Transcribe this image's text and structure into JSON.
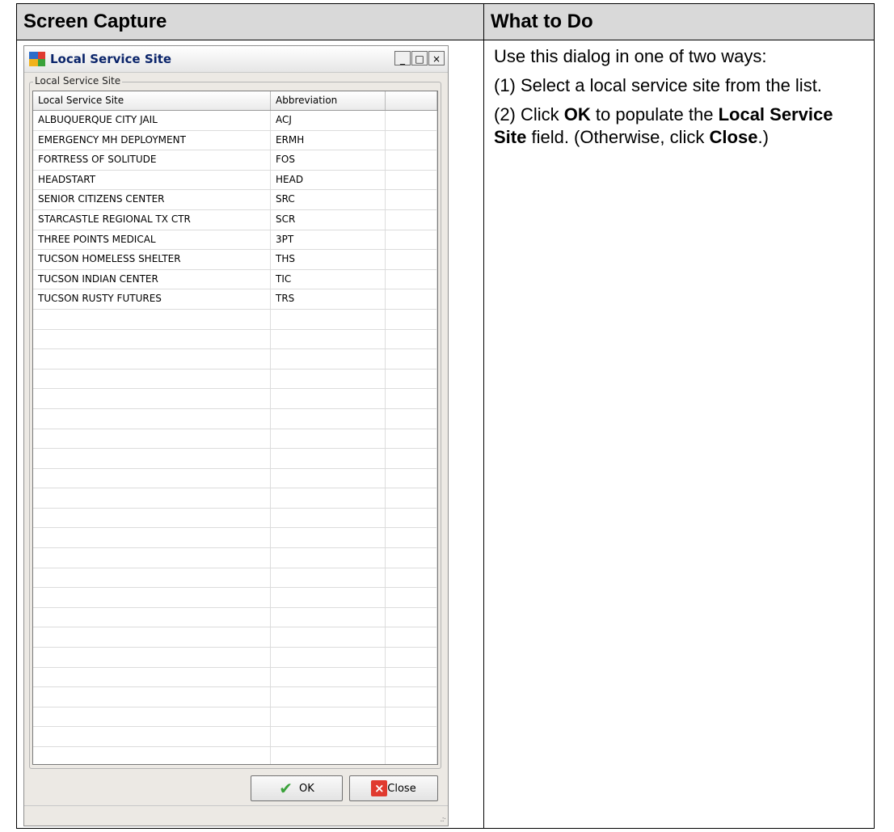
{
  "table": {
    "header_left": "Screen Capture",
    "header_right": "What to Do"
  },
  "dialog": {
    "title": "Local Service Site",
    "window_buttons": {
      "minimize": "_",
      "maximize": "□",
      "close": "×"
    },
    "group_label": "Local Service Site",
    "columns": [
      "Local Service Site",
      "Abbreviation",
      ""
    ],
    "rows": [
      {
        "site": "ALBUQUERQUE CITY JAIL",
        "abbr": "ACJ"
      },
      {
        "site": "EMERGENCY MH DEPLOYMENT",
        "abbr": "ERMH"
      },
      {
        "site": "FORTRESS OF SOLITUDE",
        "abbr": "FOS"
      },
      {
        "site": "HEADSTART",
        "abbr": "HEAD"
      },
      {
        "site": "SENIOR CITIZENS CENTER",
        "abbr": "SRC"
      },
      {
        "site": "STARCASTLE REGIONAL TX CTR",
        "abbr": "SCR"
      },
      {
        "site": "THREE POINTS MEDICAL",
        "abbr": "3PT"
      },
      {
        "site": "TUCSON HOMELESS SHELTER",
        "abbr": "THS"
      },
      {
        "site": "TUCSON INDIAN CENTER",
        "abbr": "TIC"
      },
      {
        "site": "TUCSON RUSTY FUTURES",
        "abbr": "TRS"
      }
    ],
    "empty_rows": 23,
    "ok_label": "OK",
    "close_label": "Close",
    "icons": {
      "app": "app-icon",
      "ok": "check-icon",
      "close": "x-icon",
      "grip": "resize-grip-icon"
    }
  },
  "instructions": {
    "intro": "Use this dialog in one of two ways:",
    "step1": "(1) Select a local service site from the list.",
    "step2": {
      "pre": "(2) Click ",
      "b1": "OK",
      "mid1": " to populate the ",
      "b2": "Local Service Site",
      "mid2": " field. (Otherwise, click ",
      "b3": "Close",
      "post": ".)"
    }
  }
}
